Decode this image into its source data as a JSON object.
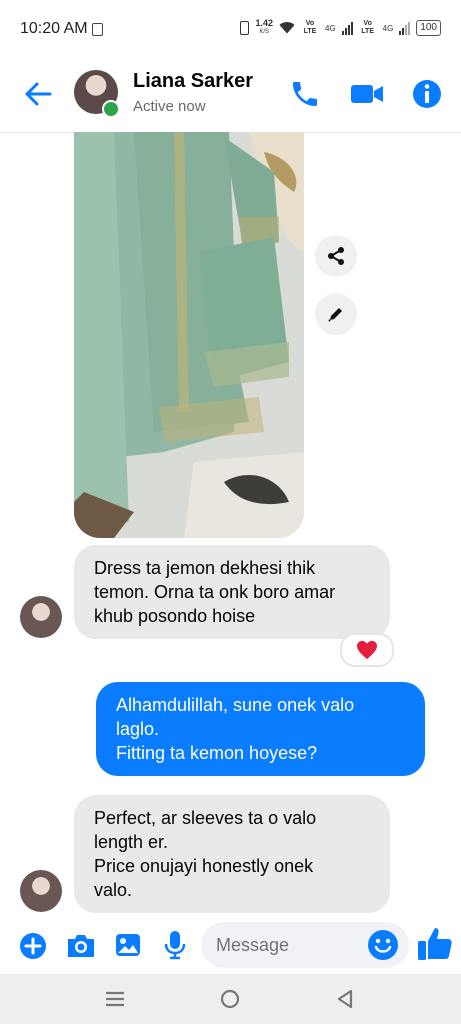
{
  "status_bar": {
    "time": "10:20 AM",
    "net_speed_value": "1.42",
    "net_speed_unit": "K/S",
    "sim1_label": "Vo LTE",
    "sim1_network": "4G",
    "sim2_label": "Vo LTE",
    "sim2_network": "4G",
    "battery": "100"
  },
  "header": {
    "contact_name": "Liana Sarker",
    "contact_status": "Active now"
  },
  "messages": [
    {
      "side": "received",
      "text_lines": [
        "Dress ta jemon dekhesi thik",
        "temon. Orna ta onk boro amar",
        "khub posondo hoise"
      ],
      "reaction": "heart"
    },
    {
      "side": "sent",
      "text_lines": [
        "Alhamdulillah, sune onek valo",
        "laglo.",
        "Fitting ta kemon hoyese?"
      ]
    },
    {
      "side": "received",
      "text_lines": [
        "Perfect, ar sleeves ta o valo",
        "length er.",
        "Price onujayi honestly onek",
        "valo."
      ]
    }
  ],
  "composer": {
    "placeholder": "Message"
  },
  "colors": {
    "accent": "#0a7cff",
    "online": "#31a24c",
    "received_bubble": "#e9e9eb",
    "reaction_heart": "#e41e3f"
  }
}
